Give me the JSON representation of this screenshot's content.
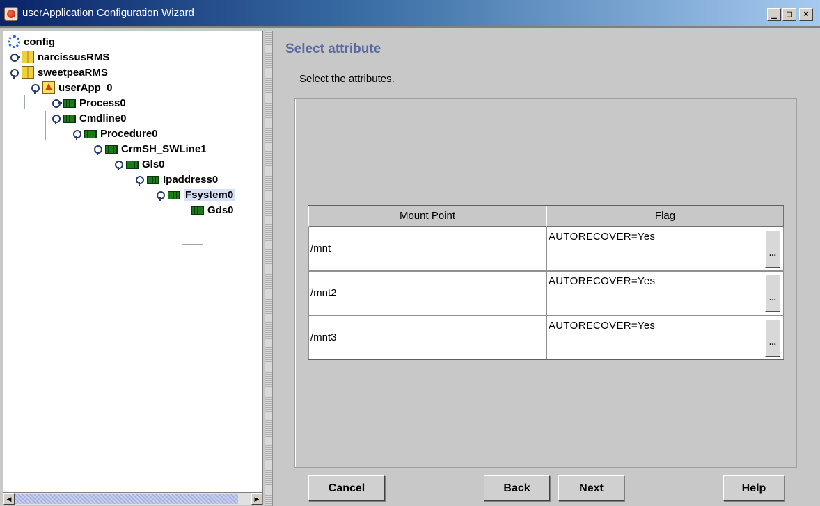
{
  "window": {
    "title": "userApplication Configuration Wizard",
    "minimize": "_",
    "maximize": "□",
    "close": "×"
  },
  "tree": {
    "nodes": [
      {
        "label": "config",
        "icon": "config-icon",
        "toggle": "none"
      },
      {
        "label": "narcissusRMS",
        "icon": "server-icon",
        "toggle": "closed"
      },
      {
        "label": "sweetpeaRMS",
        "icon": "server-icon",
        "toggle": "open"
      },
      {
        "label": "userApp_0",
        "icon": "userapp-icon",
        "toggle": "open"
      },
      {
        "label": "Process0",
        "icon": "resource-icon",
        "toggle": "closed"
      },
      {
        "label": "Cmdline0",
        "icon": "resource-icon",
        "toggle": "open"
      },
      {
        "label": "Procedure0",
        "icon": "resource-icon",
        "toggle": "open"
      },
      {
        "label": "CrmSH_SWLine1",
        "icon": "resource-icon",
        "toggle": "open"
      },
      {
        "label": "Gls0",
        "icon": "resource-icon",
        "toggle": "open"
      },
      {
        "label": "Ipaddress0",
        "icon": "resource-icon",
        "toggle": "open"
      },
      {
        "label": "Fsystem0",
        "icon": "resource-icon",
        "toggle": "open",
        "selected": true
      },
      {
        "label": "Gds0",
        "icon": "resource-icon",
        "toggle": "none"
      }
    ]
  },
  "main": {
    "title": "Select attribute",
    "instruction": "Select the attributes.",
    "table": {
      "columns": [
        "Mount Point",
        "Flag"
      ],
      "rows": [
        {
          "mount_point": "/mnt",
          "flag": "AUTORECOVER=Yes",
          "edit": "..."
        },
        {
          "mount_point": "/mnt2",
          "flag": "AUTORECOVER=Yes",
          "edit": "..."
        },
        {
          "mount_point": "/mnt3",
          "flag": "AUTORECOVER=Yes",
          "edit": "..."
        }
      ]
    }
  },
  "buttons": {
    "cancel": "Cancel",
    "back": "Back",
    "next": "Next",
    "help": "Help"
  }
}
